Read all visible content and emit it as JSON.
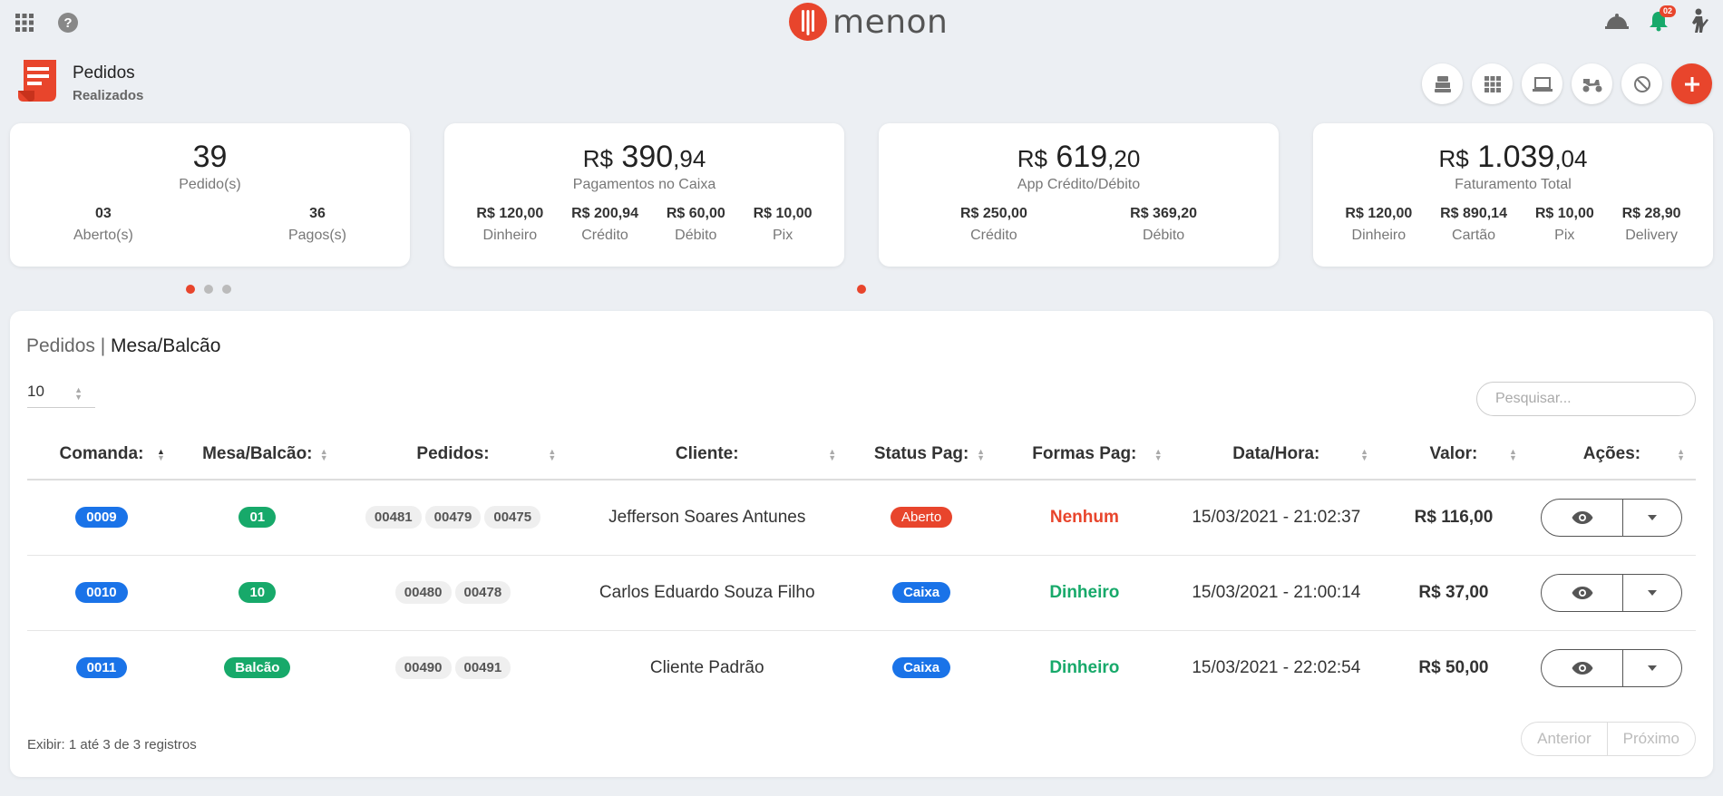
{
  "app": {
    "logo_text": "menon",
    "notification_count": "02"
  },
  "page": {
    "title": "Pedidos",
    "subtitle": "Realizados"
  },
  "cards": [
    {
      "big": "39",
      "label": "Pedido(s)",
      "subs": [
        {
          "value": "03",
          "label": "Aberto(s)"
        },
        {
          "value": "36",
          "label": "Pagos(s)"
        }
      ]
    },
    {
      "currency": "R$",
      "int": "390",
      "cents": ",94",
      "label": "Pagamentos no Caixa",
      "subs": [
        {
          "value": "R$ 120,00",
          "label": "Dinheiro"
        },
        {
          "value": "R$ 200,94",
          "label": "Crédito"
        },
        {
          "value": "R$ 60,00",
          "label": "Débito"
        },
        {
          "value": "R$ 10,00",
          "label": "Pix"
        }
      ]
    },
    {
      "currency": "R$",
      "int": "619",
      "cents": ",20",
      "label": "App Crédito/Débito",
      "subs": [
        {
          "value": "R$ 250,00",
          "label": "Crédito"
        },
        {
          "value": "R$ 369,20",
          "label": "Débito"
        }
      ]
    },
    {
      "currency": "R$",
      "int": "1.039",
      "cents": ",04",
      "label": "Faturamento Total",
      "subs": [
        {
          "value": "R$ 120,00",
          "label": "Dinheiro"
        },
        {
          "value": "R$ 890,14",
          "label": "Cartão"
        },
        {
          "value": "R$ 10,00",
          "label": "Pix"
        },
        {
          "value": "R$ 28,90",
          "label": "Delivery"
        }
      ]
    }
  ],
  "panel": {
    "title_prefix": "Pedidos | ",
    "title_main": "Mesa/Balcão",
    "page_length": "10",
    "search_placeholder": "Pesquisar...",
    "columns": [
      "Comanda:",
      "Mesa/Balcão:",
      "Pedidos:",
      "Cliente:",
      "Status Pag:",
      "Formas Pag:",
      "Data/Hora:",
      "Valor:",
      "Ações:"
    ],
    "rows": [
      {
        "comanda": "0009",
        "mesa": "01",
        "pedidos": [
          "00481",
          "00479",
          "00475"
        ],
        "cliente": "Jefferson Soares Antunes",
        "status": "Aberto",
        "forma": "Nenhum",
        "data": "15/03/2021 - 21:02:37",
        "valor": "R$ 116,00"
      },
      {
        "comanda": "0010",
        "mesa": "10",
        "pedidos": [
          "00480",
          "00478"
        ],
        "cliente": "Carlos Eduardo Souza Filho",
        "status": "Caixa",
        "forma": "Dinheiro",
        "data": "15/03/2021 - 21:00:14",
        "valor": "R$ 37,00"
      },
      {
        "comanda": "0011",
        "mesa": "Balcão",
        "pedidos": [
          "00490",
          "00491"
        ],
        "cliente": "Cliente Padrão",
        "status": "Caixa",
        "forma": "Dinheiro",
        "data": "15/03/2021 - 22:02:54",
        "valor": "R$ 50,00"
      }
    ],
    "info": "Exibir: 1 até 3 de 3 registros",
    "prev": "Anterior",
    "next": "Próximo"
  },
  "colors": {
    "accent": "#e8452c",
    "blue": "#1a73e8",
    "green": "#17a96a"
  }
}
